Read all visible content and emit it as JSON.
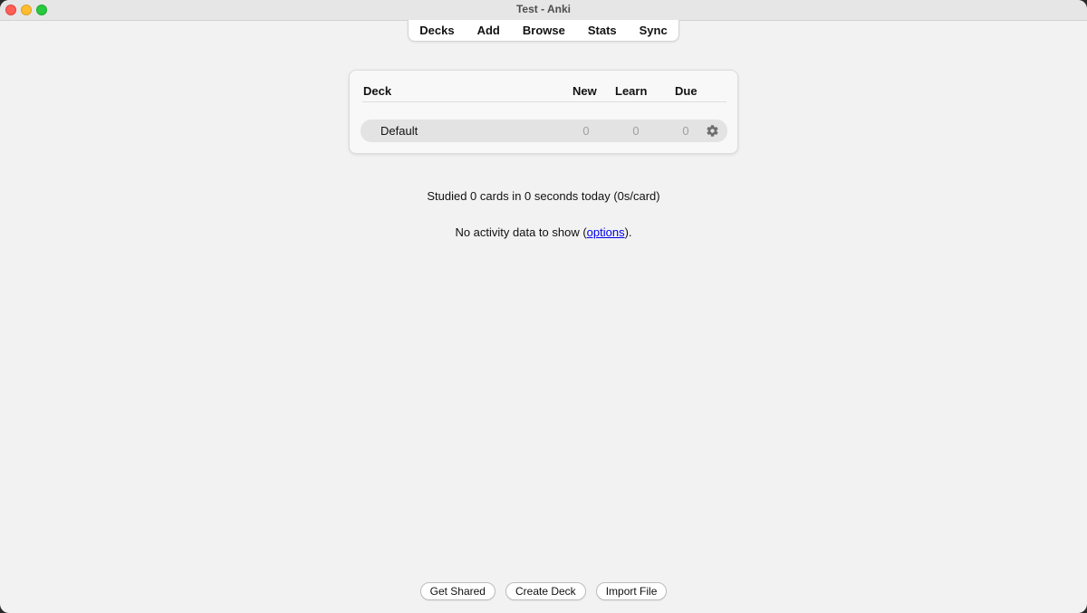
{
  "window": {
    "title": "Test - Anki"
  },
  "toolbar": {
    "items": [
      {
        "label": "Decks"
      },
      {
        "label": "Add"
      },
      {
        "label": "Browse"
      },
      {
        "label": "Stats"
      },
      {
        "label": "Sync"
      }
    ]
  },
  "deck_table": {
    "headers": {
      "deck": "Deck",
      "new": "New",
      "learn": "Learn",
      "due": "Due"
    },
    "rows": [
      {
        "name": "Default",
        "new": "0",
        "learn": "0",
        "due": "0",
        "options_icon": "gear-icon"
      }
    ]
  },
  "stats": {
    "studied_text": "Studied 0 cards in 0 seconds today (0s/card)",
    "activity_prefix": "No activity data to show (",
    "activity_link": "options",
    "activity_suffix": ")."
  },
  "bottom_buttons": {
    "get_shared": "Get Shared",
    "create_deck": "Create Deck",
    "import_file": "Import File"
  },
  "colors": {
    "close": "#fe5f57",
    "minimize": "#febc2e",
    "maximize": "#28c840",
    "link": "#0000ee",
    "count_zero": "#a0a0a0",
    "row_highlight": "#e3e3e3"
  }
}
